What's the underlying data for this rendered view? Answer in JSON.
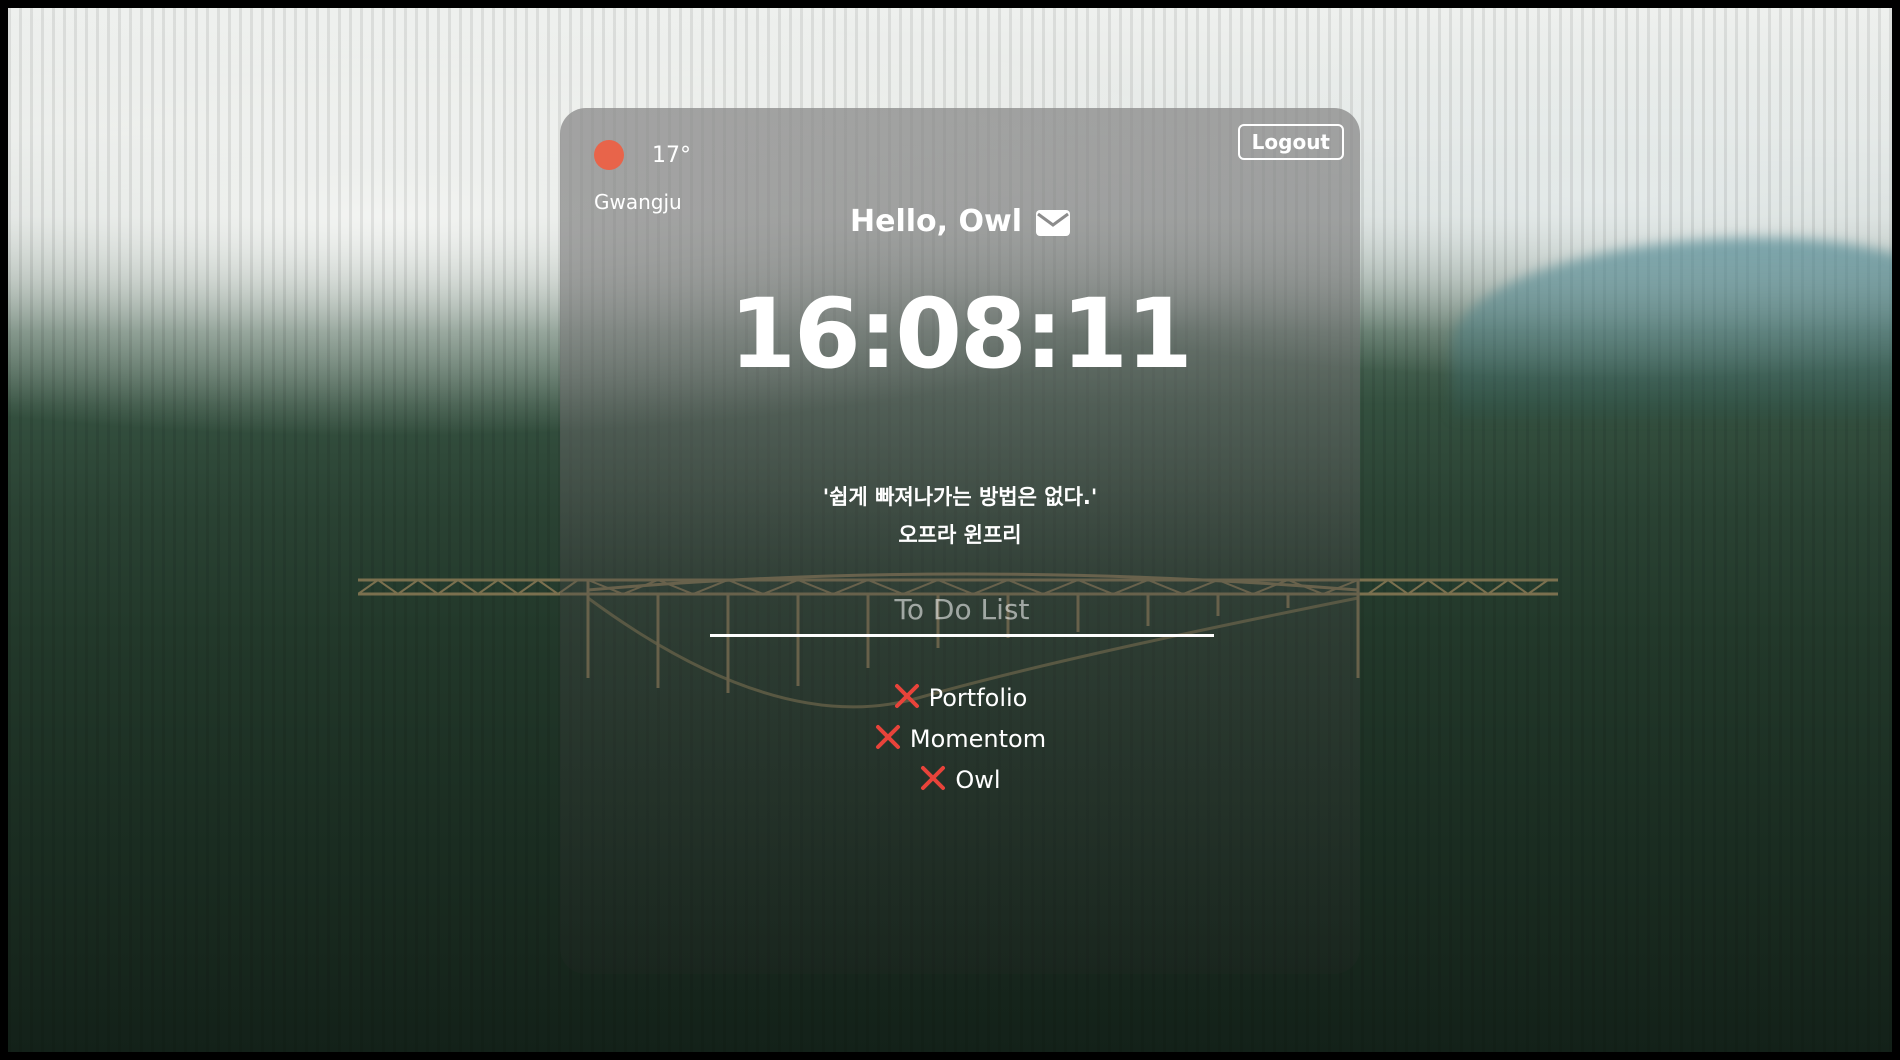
{
  "weather": {
    "icon": "weather-circle-icon",
    "icon_color": "#e8644a",
    "temperature": "17°",
    "city": "Gwangju"
  },
  "header": {
    "logout_label": "Logout"
  },
  "greeting": {
    "text": "Hello, Owl",
    "icon": "envelope-icon"
  },
  "clock": {
    "time": "16:08:11"
  },
  "quote": {
    "text": "'쉽게 빠져나가는 방법은 없다.'",
    "author": "오프라 윈프리"
  },
  "todo": {
    "placeholder": "To Do List",
    "value": "",
    "delete_icon": "x-icon",
    "delete_color": "#e8433a",
    "items": [
      {
        "label": "Portfolio"
      },
      {
        "label": "Momentom"
      },
      {
        "label": "Owl"
      }
    ]
  }
}
